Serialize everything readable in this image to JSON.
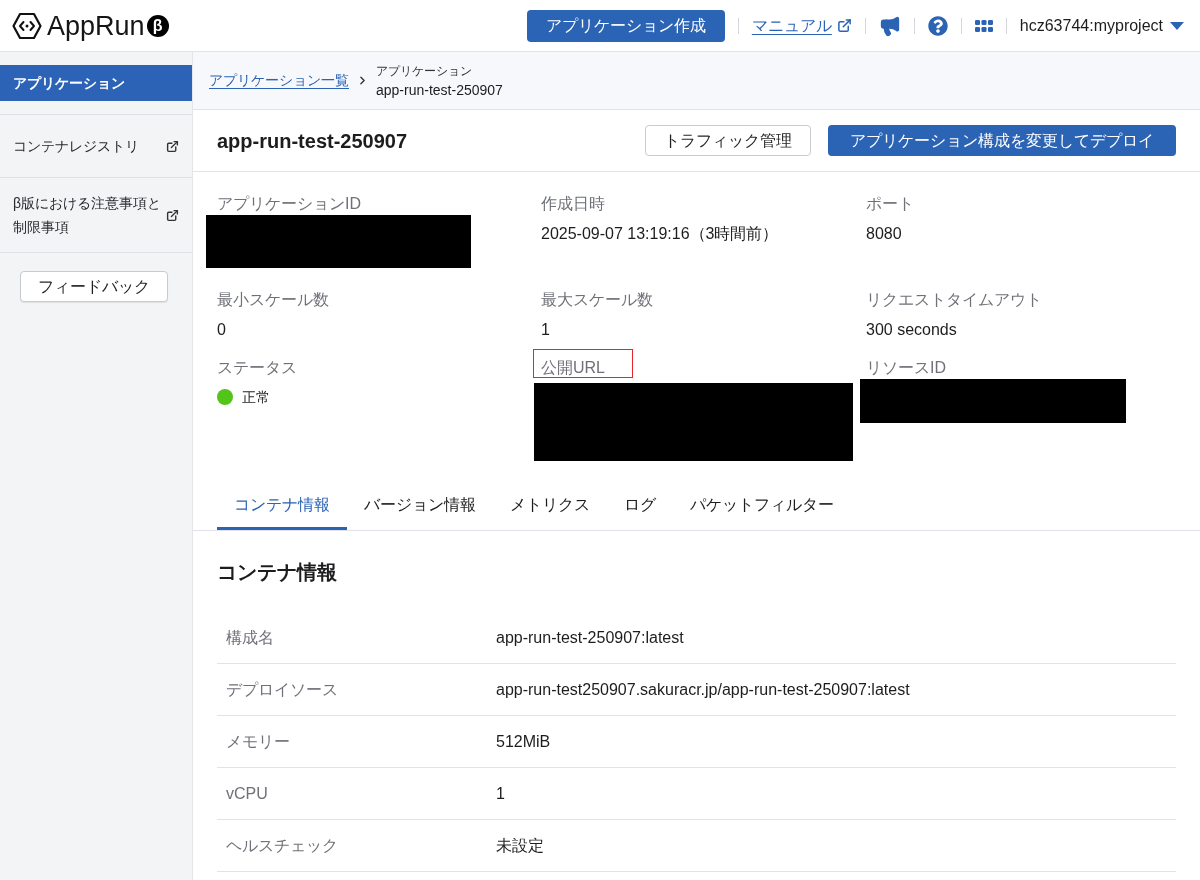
{
  "header": {
    "logo": {
      "name": "AppRun",
      "badge": "β"
    },
    "create_button": "アプリケーション作成",
    "manual_link": "マニュアル",
    "account": "hcz63744:myproject"
  },
  "sidebar": {
    "items": [
      {
        "label": "アプリケーション",
        "selected": true,
        "external": false
      },
      {
        "label": "コンテナレジストリ",
        "selected": false,
        "external": true
      },
      {
        "label": "β版における注意事項と制限事項",
        "selected": false,
        "external": true
      }
    ],
    "feedback_button": "フィードバック"
  },
  "breadcrumb": {
    "link": "アプリケーション一覧",
    "current_type": "アプリケーション",
    "current_name": "app-run-test-250907"
  },
  "title": "app-run-test-250907",
  "actions": [
    {
      "label": "トラフィック管理",
      "kind": "outline"
    },
    {
      "label": "アプリケーション構成を変更してデプロイ",
      "kind": "primary"
    }
  ],
  "fields": [
    {
      "label": "アプリケーションID",
      "kind": "redacted",
      "highlighted": false
    },
    {
      "label": "作成日時",
      "kind": "text",
      "value": "2025-09-07 13:19:16（3時間前）",
      "highlighted": false
    },
    {
      "label": "ポート",
      "kind": "text",
      "value": "8080",
      "highlighted": false
    },
    {
      "label": "最小スケール数",
      "kind": "text",
      "value": "0",
      "highlighted": false
    },
    {
      "label": "最大スケール数",
      "kind": "text",
      "value": "1",
      "highlighted": false
    },
    {
      "label": "リクエストタイムアウト",
      "kind": "text",
      "value": "300 seconds",
      "highlighted": false
    },
    {
      "label": "ステータス",
      "kind": "status",
      "value": "正常",
      "color": "#52c41a",
      "highlighted": false
    },
    {
      "label": "公開URL",
      "kind": "redacted",
      "highlighted": true
    },
    {
      "label": "リソースID",
      "kind": "redacted",
      "highlighted": false
    }
  ],
  "tabs": [
    {
      "label": "コンテナ情報",
      "selected": true
    },
    {
      "label": "バージョン情報",
      "selected": false
    },
    {
      "label": "メトリクス",
      "selected": false
    },
    {
      "label": "ログ",
      "selected": false
    },
    {
      "label": "パケットフィルター",
      "selected": false
    }
  ],
  "container_info": {
    "heading": "コンテナ情報",
    "rows": [
      {
        "label": "構成名",
        "value": "app-run-test-250907:latest"
      },
      {
        "label": "デプロイソース",
        "value": "app-run-test250907.sakuracr.jp/app-run-test-250907:latest"
      },
      {
        "label": "メモリー",
        "value": "512MiB"
      },
      {
        "label": "vCPU",
        "value": "1"
      },
      {
        "label": "ヘルスチェック",
        "value": "未設定"
      }
    ]
  }
}
